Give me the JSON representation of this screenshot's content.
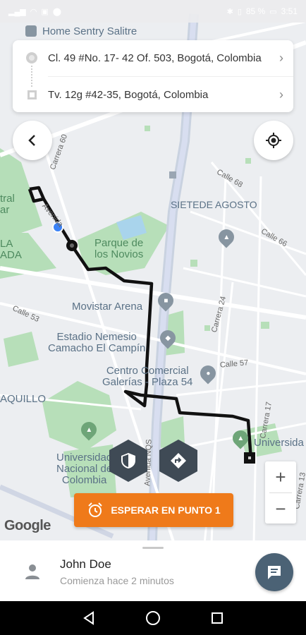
{
  "status_bar": {
    "battery": "85 %",
    "time": "3:51"
  },
  "map": {
    "labels": {
      "home_sentry": "Home Sentry Salitre",
      "siete_agosto": "SIETEDE AGOSTO",
      "parque": "Parque de\nlos Novios",
      "movistar": "Movistar Arena",
      "estadio": "Estadio Nemesio\nCamacho El Campín",
      "centro": "Centro Comercial\nGalerías - Plaza 54",
      "universidad_nacional": "Universidad\nNacional de\nColombia",
      "universidad_right": "Universida",
      "quillo": "AQUILLO",
      "tral": "tral\nar",
      "la": "LA\nADA"
    },
    "streets": {
      "carrera60": "Carrera 60",
      "avenida": "Avenida",
      "calle68": "Calle 68",
      "calle66": "Calle 66",
      "calle53": "Calle 53",
      "carrera24": "Carrera 24",
      "calle57": "Calle 57",
      "carrera17": "Carrera 17",
      "av_nqs": "Avenida NQS",
      "carrera13": "Carrera 13"
    },
    "google": "Google"
  },
  "route": {
    "origin": "Cl. 49 #No. 17- 42 Of. 503, Bogotá, Colombia",
    "destination": "Tv. 12g #42-35, Bogotá, Colombia"
  },
  "actions": {
    "wait_button": "ESPERAR EN PUNTO 1",
    "zoom_in": "+",
    "zoom_out": "−"
  },
  "driver": {
    "name": "John Doe",
    "subtitle": "Comienza hace 2 minutos"
  },
  "colors": {
    "accent": "#ef7a1a",
    "chat": "#4b6275",
    "route": "#111111",
    "park": "#b7dfb9"
  }
}
